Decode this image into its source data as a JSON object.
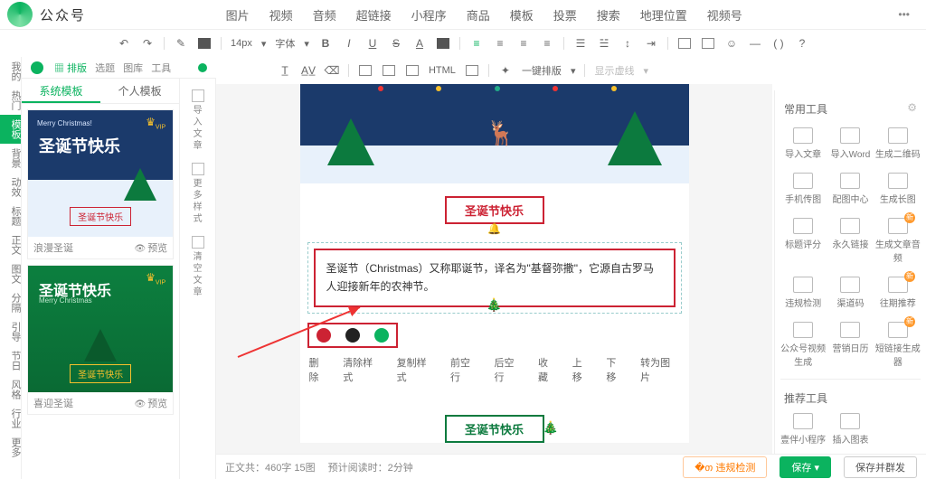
{
  "header": {
    "brand": "公众号",
    "menu": [
      "图片",
      "视频",
      "音频",
      "超链接",
      "小程序",
      "商品",
      "模板",
      "投票",
      "搜索",
      "地理位置",
      "视频号"
    ],
    "more": "•••"
  },
  "toolbar1": {
    "fontsize": "14px",
    "fontfam": "字体",
    "oneKey": "一键排版",
    "baseline": "显示虚线"
  },
  "subbar": {
    "items": [
      "排版",
      "选题",
      "图库",
      "工具"
    ]
  },
  "leftTabs": {
    "sys": "系统模板",
    "user": "个人模板"
  },
  "sideTools": [
    "导入文章",
    "更多样式",
    "清空文章"
  ],
  "templates": [
    {
      "mc": "Merry Christmas!",
      "title": "圣诞节快乐",
      "pill": "圣诞节快乐",
      "name": "浪漫圣诞",
      "preview": "预览",
      "theme": "blue"
    },
    {
      "mc": "Merry Christmas",
      "title": "圣诞节快乐",
      "pill": "圣诞节快乐",
      "name": "喜迎圣诞",
      "preview": "预览",
      "theme": "green"
    }
  ],
  "rail": [
    "我的",
    "热门",
    "模板",
    "背景",
    "动效",
    "标题",
    "正文",
    "图文",
    "分隔",
    "引导",
    "节日",
    "风格",
    "行业",
    "更多"
  ],
  "railActive": 2,
  "canvas": {
    "badge1": "圣诞节快乐",
    "paragraph": "圣诞节（Christmas）又称耶诞节，译名为\"基督弥撒\"，它源自古罗马人迎接新年的农神节。",
    "ops": [
      "删除",
      "清除样式",
      "复制样式",
      "前空行",
      "后空行",
      "收藏",
      "上移",
      "下移",
      "转为图片"
    ],
    "badge2": "圣诞节快乐"
  },
  "rpanel": {
    "title": "常用工具",
    "tools": [
      "导入文章",
      "导入Word",
      "生成二维码",
      "手机传图",
      "配图中心",
      "生成长图",
      "标题评分",
      "永久链接",
      "生成文章音频",
      "违规检测",
      "渠道码",
      "往期推荐",
      "公众号视频生成",
      "营销日历",
      "短链接生成器"
    ],
    "newFlags": [
      8,
      11,
      14
    ],
    "rec": "推荐工具",
    "rec_items": [
      "壹伴小程序",
      "插入图表"
    ]
  },
  "footer": {
    "stats1": "正文共：",
    "stats1v": "460字 15图",
    "stats2": "预计阅读时：",
    "stats2v": "2分钟",
    "check": "违规检测",
    "save": "保存",
    "savepub": "保存并群发"
  }
}
